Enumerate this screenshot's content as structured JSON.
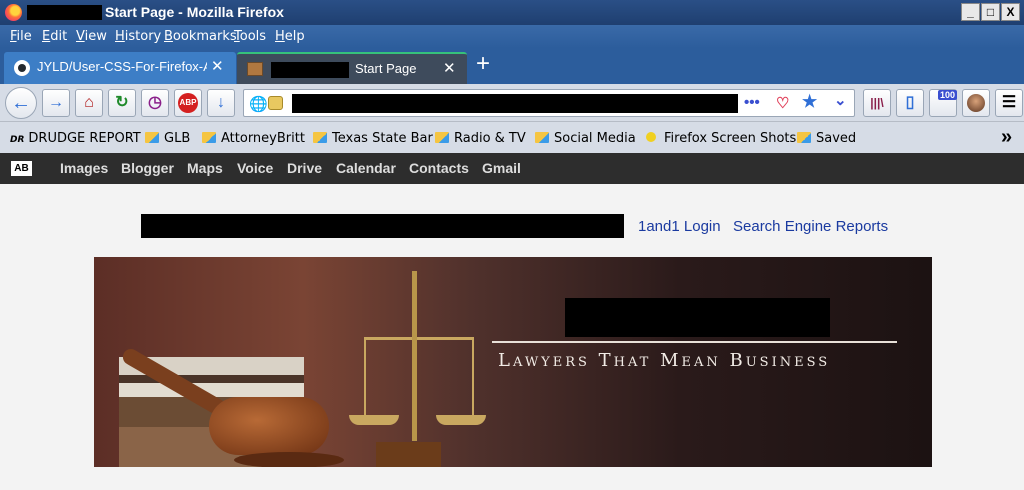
{
  "window": {
    "title": "Start Page - Mozilla Firefox",
    "controls": [
      "_",
      "□",
      "X"
    ]
  },
  "menubar": {
    "items": [
      "File",
      "Edit",
      "View",
      "History",
      "Bookmarks",
      "Tools",
      "Help"
    ]
  },
  "tabs": [
    {
      "label": "JYLD/User-CSS-For-Firefox-At",
      "icon": "github-icon",
      "close": "✕"
    },
    {
      "label": "Start Page",
      "icon": "house-icon",
      "close": "✕",
      "active": true
    }
  ],
  "new_tab": "+",
  "toolbar": {
    "back": "←",
    "forward": "→",
    "home": "⌂",
    "reload": "↻",
    "history": "◷",
    "abp": "ABP",
    "download": "↓",
    "page_actions": "•••",
    "bookmark_star": "★",
    "dropdown": "⌄",
    "library": "|||\\",
    "sidebar": "▯",
    "badge_count": "100",
    "menu": "☰"
  },
  "bookmarks": [
    {
      "label": "DRUDGE REPORT",
      "icon": "dr"
    },
    {
      "label": "GLB",
      "icon": "folder"
    },
    {
      "label": "AttorneyBritt",
      "icon": "folder"
    },
    {
      "label": "Texas State Bar",
      "icon": "folder"
    },
    {
      "label": "Radio & TV",
      "icon": "folder"
    },
    {
      "label": "Social Media",
      "icon": "folder"
    },
    {
      "label": "Firefox Screen Shots",
      "icon": "dot"
    },
    {
      "label": "Saved",
      "icon": "folder"
    }
  ],
  "bookmarks_overflow": "»",
  "google_bar": {
    "logo": "AB",
    "links": [
      "Images",
      "Blogger",
      "Maps",
      "Voice",
      "Drive",
      "Calendar",
      "Contacts",
      "Gmail"
    ]
  },
  "page": {
    "links": [
      "1and1 Login",
      "Search Engine Reports"
    ],
    "banner_tagline": "Lawyers That Mean Business"
  },
  "colors": {
    "titlebar": "#1f3f70",
    "menubar": "#2c5d9c",
    "active_tab_indicator": "#36c17b",
    "link": "#1a3aa0"
  }
}
